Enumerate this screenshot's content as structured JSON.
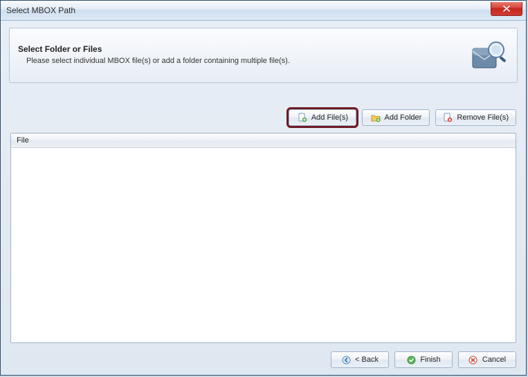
{
  "window": {
    "title": "Select MBOX Path"
  },
  "header": {
    "title": "Select Folder or Files",
    "subtitle": "Please select individual MBOX file(s) or add a folder containing multiple file(s)."
  },
  "toolbar": {
    "add_files": "Add File(s)",
    "add_folder": "Add Folder",
    "remove_files": "Remove File(s)"
  },
  "list": {
    "column_header": "File",
    "rows": []
  },
  "footer": {
    "back": "< Back",
    "finish": "Finish",
    "cancel": "Cancel"
  }
}
